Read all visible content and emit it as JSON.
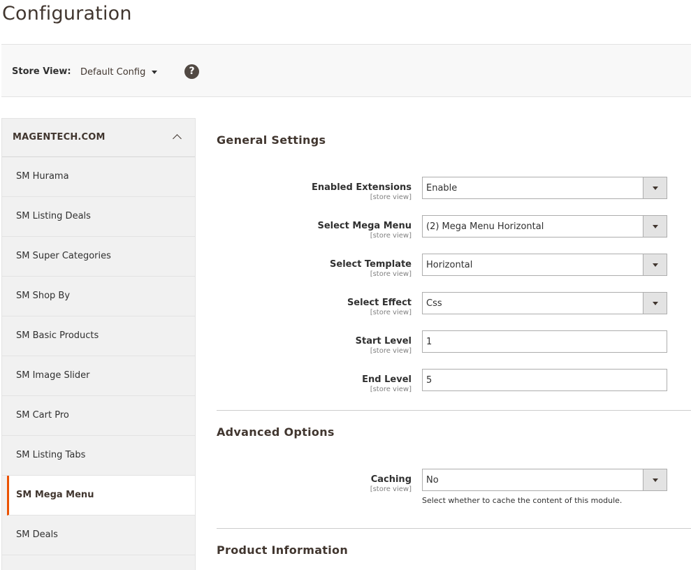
{
  "page": {
    "title": "Configuration"
  },
  "store_switcher": {
    "label": "Store View:",
    "value": "Default Config"
  },
  "sidebar": {
    "title": "MAGENTECH.COM",
    "items": [
      {
        "label": "SM Hurama"
      },
      {
        "label": "SM Listing Deals"
      },
      {
        "label": "SM Super Categories"
      },
      {
        "label": "SM Shop By"
      },
      {
        "label": "SM Basic Products"
      },
      {
        "label": "SM Image Slider"
      },
      {
        "label": "SM Cart Pro"
      },
      {
        "label": "SM Listing Tabs"
      },
      {
        "label": "SM Mega Menu"
      },
      {
        "label": "SM Deals"
      }
    ],
    "active_item": "SM Mega Menu"
  },
  "general": {
    "title": "General Settings",
    "scope": "[store view]",
    "fields": {
      "enabled": {
        "label": "Enabled Extensions",
        "value": "Enable"
      },
      "mega_menu": {
        "label": "Select Mega Menu",
        "value": "(2) Mega Menu Horizontal"
      },
      "template": {
        "label": "Select Template",
        "value": "Horizontal"
      },
      "effect": {
        "label": "Select Effect",
        "value": "Css"
      },
      "start_level": {
        "label": "Start Level",
        "value": "1"
      },
      "end_level": {
        "label": "End Level",
        "value": "5"
      }
    }
  },
  "advanced": {
    "title": "Advanced Options",
    "caching": {
      "label": "Caching",
      "value": "No",
      "note": "Select whether to cache the content of this module."
    }
  },
  "product": {
    "title": "Product Information"
  },
  "colors": {
    "accent": "#eb5202",
    "sidebar_bg": "#f1f1f1",
    "header_bg": "#f8f8f8"
  }
}
